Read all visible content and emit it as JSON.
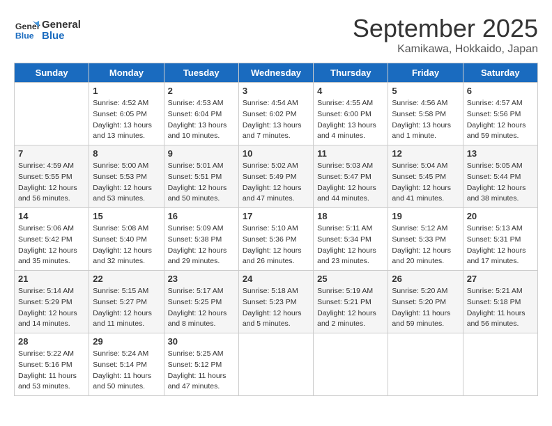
{
  "header": {
    "logo_line1": "General",
    "logo_line2": "Blue",
    "month_title": "September 2025",
    "subtitle": "Kamikawa, Hokkaido, Japan"
  },
  "weekdays": [
    "Sunday",
    "Monday",
    "Tuesday",
    "Wednesday",
    "Thursday",
    "Friday",
    "Saturday"
  ],
  "weeks": [
    [
      {
        "day": "",
        "info": ""
      },
      {
        "day": "1",
        "info": "Sunrise: 4:52 AM\nSunset: 6:05 PM\nDaylight: 13 hours\nand 13 minutes."
      },
      {
        "day": "2",
        "info": "Sunrise: 4:53 AM\nSunset: 6:04 PM\nDaylight: 13 hours\nand 10 minutes."
      },
      {
        "day": "3",
        "info": "Sunrise: 4:54 AM\nSunset: 6:02 PM\nDaylight: 13 hours\nand 7 minutes."
      },
      {
        "day": "4",
        "info": "Sunrise: 4:55 AM\nSunset: 6:00 PM\nDaylight: 13 hours\nand 4 minutes."
      },
      {
        "day": "5",
        "info": "Sunrise: 4:56 AM\nSunset: 5:58 PM\nDaylight: 13 hours\nand 1 minute."
      },
      {
        "day": "6",
        "info": "Sunrise: 4:57 AM\nSunset: 5:56 PM\nDaylight: 12 hours\nand 59 minutes."
      }
    ],
    [
      {
        "day": "7",
        "info": "Sunrise: 4:59 AM\nSunset: 5:55 PM\nDaylight: 12 hours\nand 56 minutes."
      },
      {
        "day": "8",
        "info": "Sunrise: 5:00 AM\nSunset: 5:53 PM\nDaylight: 12 hours\nand 53 minutes."
      },
      {
        "day": "9",
        "info": "Sunrise: 5:01 AM\nSunset: 5:51 PM\nDaylight: 12 hours\nand 50 minutes."
      },
      {
        "day": "10",
        "info": "Sunrise: 5:02 AM\nSunset: 5:49 PM\nDaylight: 12 hours\nand 47 minutes."
      },
      {
        "day": "11",
        "info": "Sunrise: 5:03 AM\nSunset: 5:47 PM\nDaylight: 12 hours\nand 44 minutes."
      },
      {
        "day": "12",
        "info": "Sunrise: 5:04 AM\nSunset: 5:45 PM\nDaylight: 12 hours\nand 41 minutes."
      },
      {
        "day": "13",
        "info": "Sunrise: 5:05 AM\nSunset: 5:44 PM\nDaylight: 12 hours\nand 38 minutes."
      }
    ],
    [
      {
        "day": "14",
        "info": "Sunrise: 5:06 AM\nSunset: 5:42 PM\nDaylight: 12 hours\nand 35 minutes."
      },
      {
        "day": "15",
        "info": "Sunrise: 5:08 AM\nSunset: 5:40 PM\nDaylight: 12 hours\nand 32 minutes."
      },
      {
        "day": "16",
        "info": "Sunrise: 5:09 AM\nSunset: 5:38 PM\nDaylight: 12 hours\nand 29 minutes."
      },
      {
        "day": "17",
        "info": "Sunrise: 5:10 AM\nSunset: 5:36 PM\nDaylight: 12 hours\nand 26 minutes."
      },
      {
        "day": "18",
        "info": "Sunrise: 5:11 AM\nSunset: 5:34 PM\nDaylight: 12 hours\nand 23 minutes."
      },
      {
        "day": "19",
        "info": "Sunrise: 5:12 AM\nSunset: 5:33 PM\nDaylight: 12 hours\nand 20 minutes."
      },
      {
        "day": "20",
        "info": "Sunrise: 5:13 AM\nSunset: 5:31 PM\nDaylight: 12 hours\nand 17 minutes."
      }
    ],
    [
      {
        "day": "21",
        "info": "Sunrise: 5:14 AM\nSunset: 5:29 PM\nDaylight: 12 hours\nand 14 minutes."
      },
      {
        "day": "22",
        "info": "Sunrise: 5:15 AM\nSunset: 5:27 PM\nDaylight: 12 hours\nand 11 minutes."
      },
      {
        "day": "23",
        "info": "Sunrise: 5:17 AM\nSunset: 5:25 PM\nDaylight: 12 hours\nand 8 minutes."
      },
      {
        "day": "24",
        "info": "Sunrise: 5:18 AM\nSunset: 5:23 PM\nDaylight: 12 hours\nand 5 minutes."
      },
      {
        "day": "25",
        "info": "Sunrise: 5:19 AM\nSunset: 5:21 PM\nDaylight: 12 hours\nand 2 minutes."
      },
      {
        "day": "26",
        "info": "Sunrise: 5:20 AM\nSunset: 5:20 PM\nDaylight: 11 hours\nand 59 minutes."
      },
      {
        "day": "27",
        "info": "Sunrise: 5:21 AM\nSunset: 5:18 PM\nDaylight: 11 hours\nand 56 minutes."
      }
    ],
    [
      {
        "day": "28",
        "info": "Sunrise: 5:22 AM\nSunset: 5:16 PM\nDaylight: 11 hours\nand 53 minutes."
      },
      {
        "day": "29",
        "info": "Sunrise: 5:24 AM\nSunset: 5:14 PM\nDaylight: 11 hours\nand 50 minutes."
      },
      {
        "day": "30",
        "info": "Sunrise: 5:25 AM\nSunset: 5:12 PM\nDaylight: 11 hours\nand 47 minutes."
      },
      {
        "day": "",
        "info": ""
      },
      {
        "day": "",
        "info": ""
      },
      {
        "day": "",
        "info": ""
      },
      {
        "day": "",
        "info": ""
      }
    ]
  ]
}
